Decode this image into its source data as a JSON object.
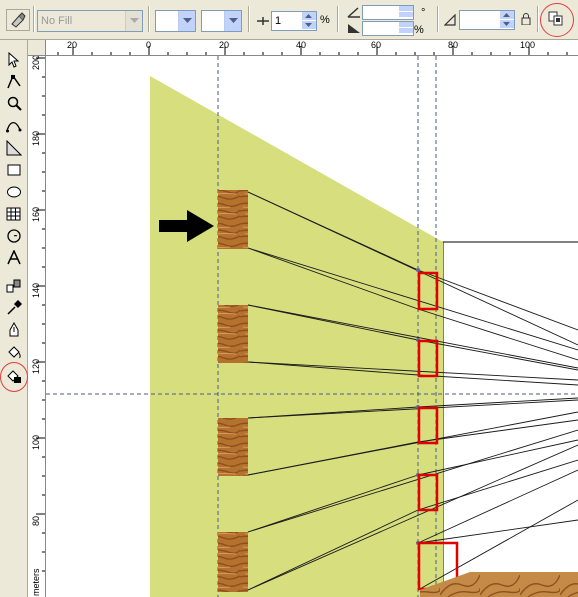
{
  "property_bar": {
    "fill_combo_value": "No Fill",
    "spin_value": "1",
    "percent_unit": "%",
    "degree_unit": "°",
    "percent_unit_2": "%"
  },
  "rulers": {
    "horizontal_ticks": [
      "20",
      "0",
      "20",
      "40",
      "60",
      "80",
      "100"
    ],
    "vertical_ticks": [
      "200",
      "180",
      "160",
      "140",
      "120",
      "100",
      "80"
    ],
    "unit_label": "meters"
  },
  "toolbox": {
    "tools": [
      "pick-tool",
      "shape-tool",
      "zoom-tool",
      "freehand-tool",
      "smart-fill-tool",
      "rectangle-tool",
      "ellipse-tool",
      "polygon-tool",
      "basic-shapes-tool",
      "text-tool",
      "interactive-blend-tool",
      "eyedropper-tool",
      "outline-tool",
      "fill-tool",
      "interactive-fill-tool"
    ],
    "highlighted_tool": "interactive-fill-tool"
  },
  "colors": {
    "ui_bg": "#ece9d8",
    "wall_fill": "#d6de7d",
    "highlight_red": "#e00000",
    "wood": "#b5712e"
  }
}
